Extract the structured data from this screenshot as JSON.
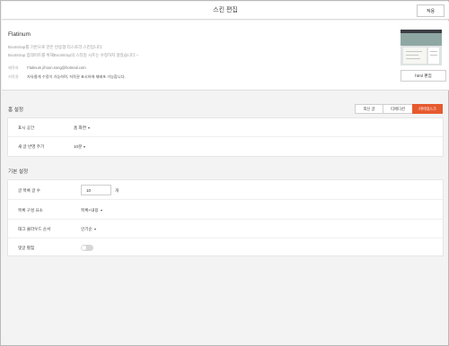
{
  "header": {
    "title": "스킨 편집",
    "apply_label": "적용"
  },
  "skin": {
    "name": "Flatinum",
    "desc_lines": [
      "Bootstrap를 기반으로 만든 반응형 티스토리 스킨입니다.",
      "Bootstrap 업데이트를 위해Bootstrap의 스타일 시트는 수정하지 않았습니다.--"
    ],
    "maker_label": "제작자",
    "maker_value": "Flatinum  jihoon.song@hotmail.com",
    "license_label": "저작권",
    "license_value": "자유롭게 수정이 가능하며, 저작권 표시하에 재배포 가능합니다.",
    "edit_button": "html 편집"
  },
  "home_settings": {
    "title": "홈 설정",
    "tabs": [
      {
        "label": "최신 글",
        "active": false
      },
      {
        "label": "티에디션",
        "active": false
      },
      {
        "label": "커버데스크",
        "active": true
      }
    ],
    "rows": [
      {
        "label": "표시 공간",
        "value": "홈 화면"
      },
      {
        "label": "새 글 반영 주기",
        "value": "10분"
      }
    ]
  },
  "basic_settings": {
    "title": "기본 설정",
    "post_count_label": "글 목록 글 수",
    "post_count_value": "10",
    "post_count_unit": "개",
    "list_elements_label": "목록 구성 요소",
    "list_elements_value": "목록+내용",
    "tag_cloud_label": "태그 클라우드 순서",
    "tag_cloud_value": "인기순",
    "comment_fold_label": "댓글 펼침",
    "comment_fold_on": false
  },
  "colors": {
    "accent": "#e65a2f"
  }
}
